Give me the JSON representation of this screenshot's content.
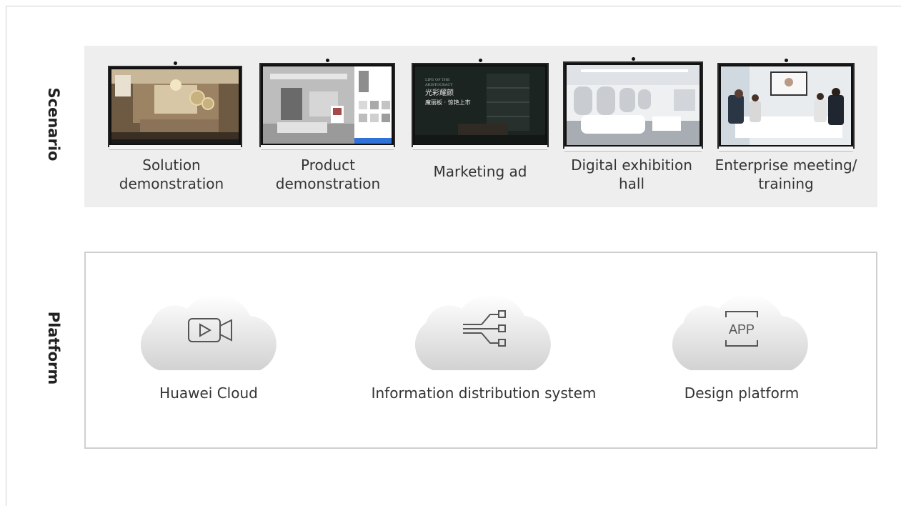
{
  "sections": {
    "scenario_label": "Scenario",
    "platform_label": "Platform"
  },
  "scenarios": [
    {
      "line1": "Solution",
      "line2": "demonstration"
    },
    {
      "line1": "Product",
      "line2": "demonstration"
    },
    {
      "line1": "Marketing ad",
      "line2": ""
    },
    {
      "line1": "Digital exhibition",
      "line2": "hall"
    },
    {
      "line1": "Enterprise meeting/",
      "line2": "training"
    }
  ],
  "screen_text": {
    "marketing_line1": "LIFE OF THE",
    "marketing_line2": "ARISTOCRACY",
    "marketing_line3": "光彩耀颜",
    "marketing_line4": "魔丽板 · 惊艳上市"
  },
  "platforms": [
    {
      "label": "Huawei Cloud",
      "icon": "video-camera-icon"
    },
    {
      "label": "Information distribution system",
      "icon": "distribution-tree-icon"
    },
    {
      "label": "Design platform",
      "icon": "app-icon",
      "icon_text": "APP"
    }
  ],
  "colors": {
    "band": "#eeeeee",
    "border": "#cfcfcf",
    "text": "#333333"
  }
}
